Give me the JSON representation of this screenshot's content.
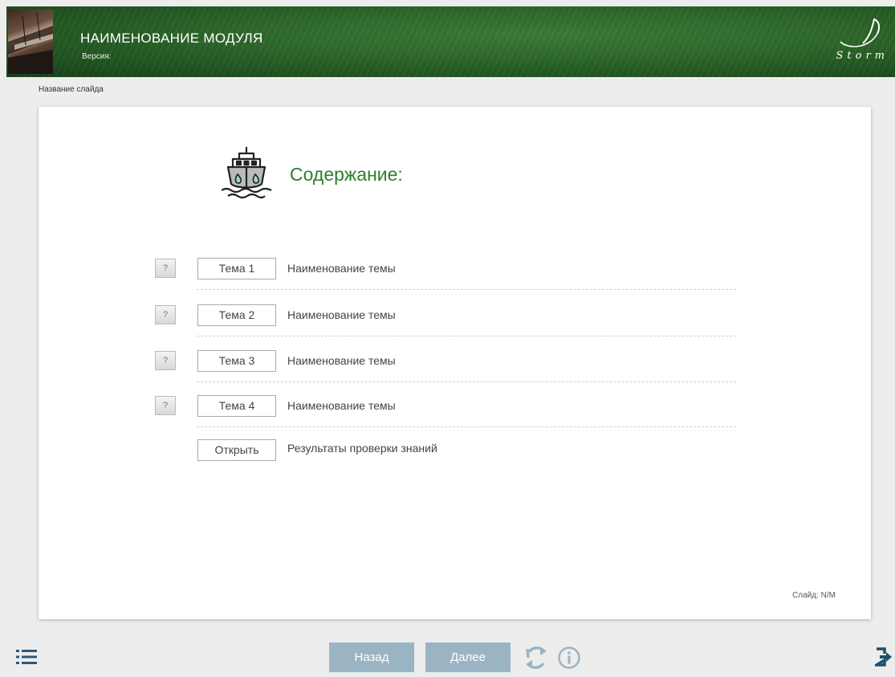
{
  "header": {
    "module_title": "НАИМЕНОВАНИЕ МОДУЛЯ",
    "version_label": "Версия:",
    "logo_text": "Storm",
    "thumbnail_icon": "ship-photo-thumbnail"
  },
  "slide": {
    "name": "Название слайда",
    "counter": "Слайд: N/M"
  },
  "toc": {
    "title": "Содержание:",
    "icon": "ship-icon",
    "topics": [
      {
        "help_label": "?",
        "button_label": "Тема 1",
        "name": "Наименование темы"
      },
      {
        "help_label": "?",
        "button_label": "Тема 2",
        "name": "Наименование темы"
      },
      {
        "help_label": "?",
        "button_label": "Тема 3",
        "name": "Наименование темы"
      },
      {
        "help_label": "?",
        "button_label": "Тема 4",
        "name": "Наименование темы"
      }
    ],
    "results": {
      "button_label": "Открыть",
      "name": "Результаты проверки знаний"
    }
  },
  "footer": {
    "back_label": "Назад",
    "next_label": "Далее",
    "icons": [
      "menu-list-icon",
      "reload-icon",
      "info-icon",
      "exit-icon"
    ]
  },
  "colors": {
    "accent_green": "#2e7d2b",
    "nav_button": "#9bb4c4",
    "header_green": "#2f6a2b"
  }
}
